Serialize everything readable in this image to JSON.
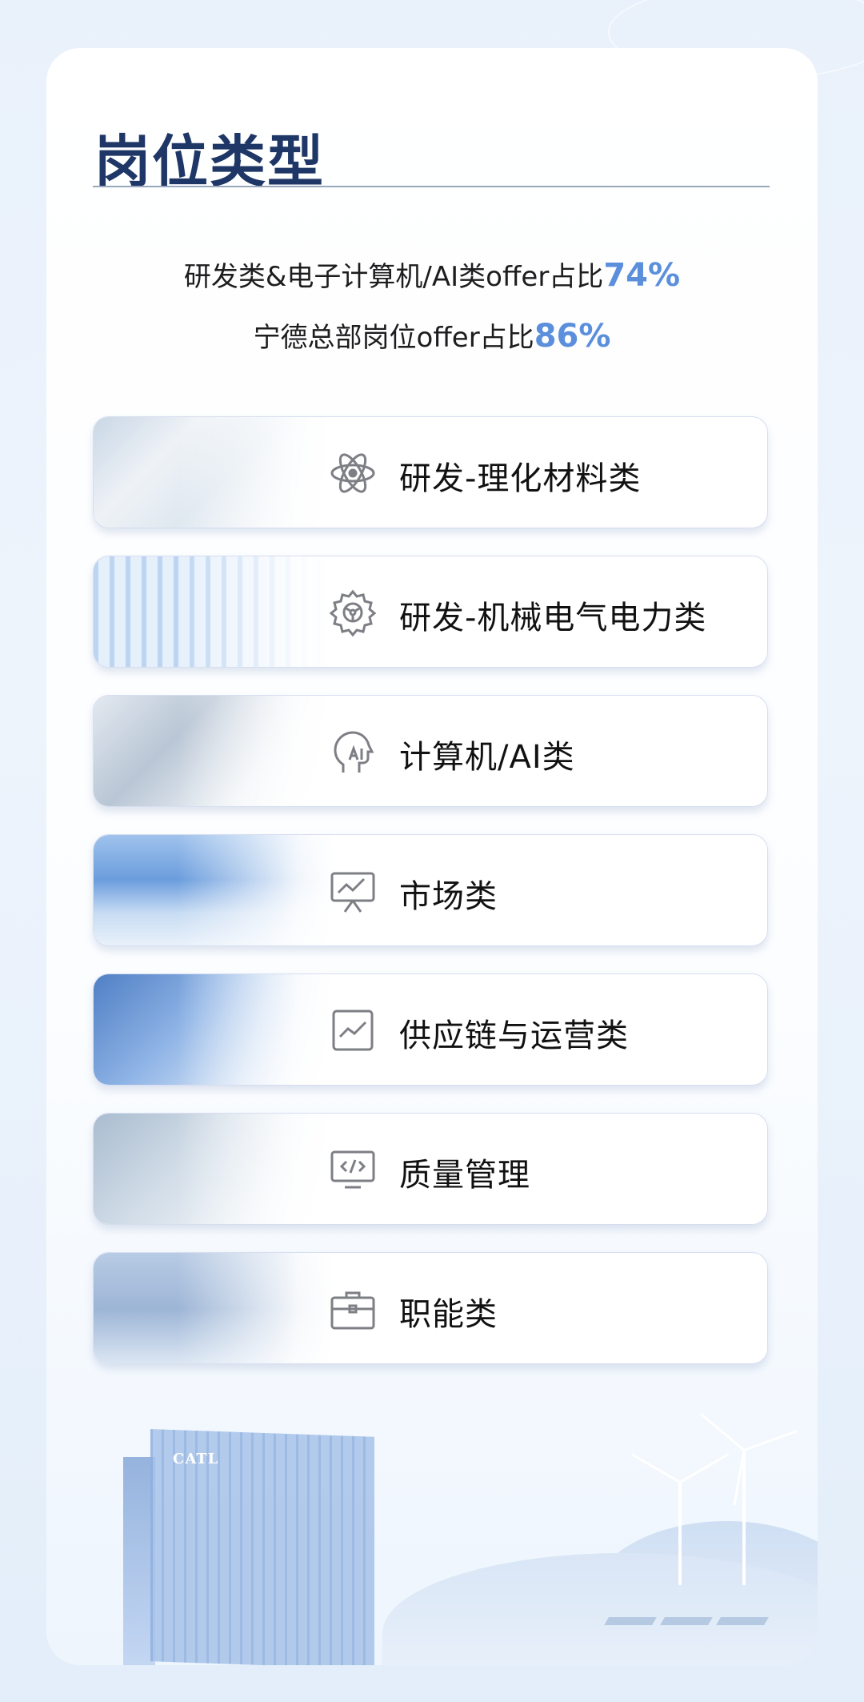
{
  "title": "岗位类型",
  "stats": {
    "line1_text": "研发类&电子计算机/AI类offer占比",
    "line1_pct": "74%",
    "line2_text": "宁德总部岗位offer占比",
    "line2_pct": "86%"
  },
  "categories": [
    {
      "label": "研发-理化材料类",
      "icon": "atom-icon"
    },
    {
      "label": "研发-机械电气电力类",
      "icon": "gear-icon"
    },
    {
      "label": "计算机/AI类",
      "icon": "ai-head-icon"
    },
    {
      "label": "市场类",
      "icon": "presentation-chart-icon"
    },
    {
      "label": "供应链与运营类",
      "icon": "trend-chart-icon"
    },
    {
      "label": "质量管理",
      "icon": "code-monitor-icon"
    },
    {
      "label": "职能类",
      "icon": "briefcase-icon"
    }
  ],
  "scene": {
    "building_logo": "CATL"
  },
  "colors": {
    "title": "#1f3766",
    "accent": "#5b8fdc",
    "icon": "#7d7f85"
  }
}
